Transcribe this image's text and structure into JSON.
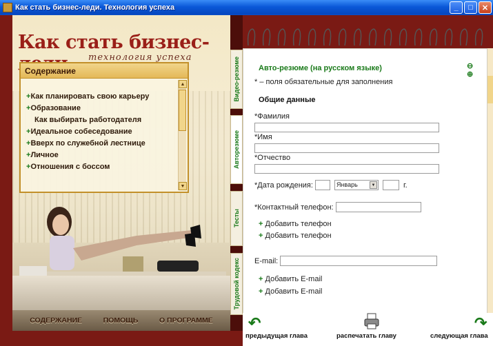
{
  "window": {
    "title": "Как стать бизнес-леди. Технология успеха",
    "min_label": "_",
    "max_label": "□",
    "close_label": "✕"
  },
  "brand": {
    "name": "Как стать бизнес-леди",
    "tagline": "технология успеха"
  },
  "toc": {
    "title": "Содержание",
    "items": [
      {
        "plus": "+",
        "label": "Как планировать свою карьеру"
      },
      {
        "plus": "+",
        "label": "Образование"
      },
      {
        "plus": "",
        "label": "Как выбирать работодателя"
      },
      {
        "plus": "+",
        "label": "Идеальное собеседование"
      },
      {
        "plus": "+",
        "label": "Вверх по служебной лестнице"
      },
      {
        "plus": "+",
        "label": "Личное"
      },
      {
        "plus": "+",
        "label": "Отношения с боссом"
      }
    ]
  },
  "bottom_nav": {
    "contents": "СОДЕРЖАНИЕ",
    "help": "ПОМОЩЬ",
    "about": "О ПРОГРАММЕ"
  },
  "tabs": [
    "Видео-резюме",
    "Авторезюме",
    "Тесты",
    "Трудовой кодекс"
  ],
  "form": {
    "title": "Авто-резюме (на русском языке)",
    "required_note": "* – поля обязательные для заполнения",
    "section": "Общие данные",
    "last_name_label": "*Фамилия",
    "first_name_label": "*Имя",
    "patronymic_label": "*Отчество",
    "dob_label": "*Дата рождения:",
    "month_value": "Январь",
    "year_suffix": "г.",
    "phone_label": "*Контактный телефон:",
    "add_phone": "Добавить телефон",
    "email_label": "E-mail:",
    "add_email": "Добавить E-mail",
    "add_plus": "+",
    "zoom_out": "⊖",
    "zoom_in": "⊕"
  },
  "footer": {
    "prev": "предыдущая глава",
    "print": "распечатать главу",
    "next": "следующая глава"
  },
  "colors": {
    "accent_green": "#1a7a1a",
    "frame_red": "#7a1a14",
    "brand_red": "#9a1f18"
  }
}
